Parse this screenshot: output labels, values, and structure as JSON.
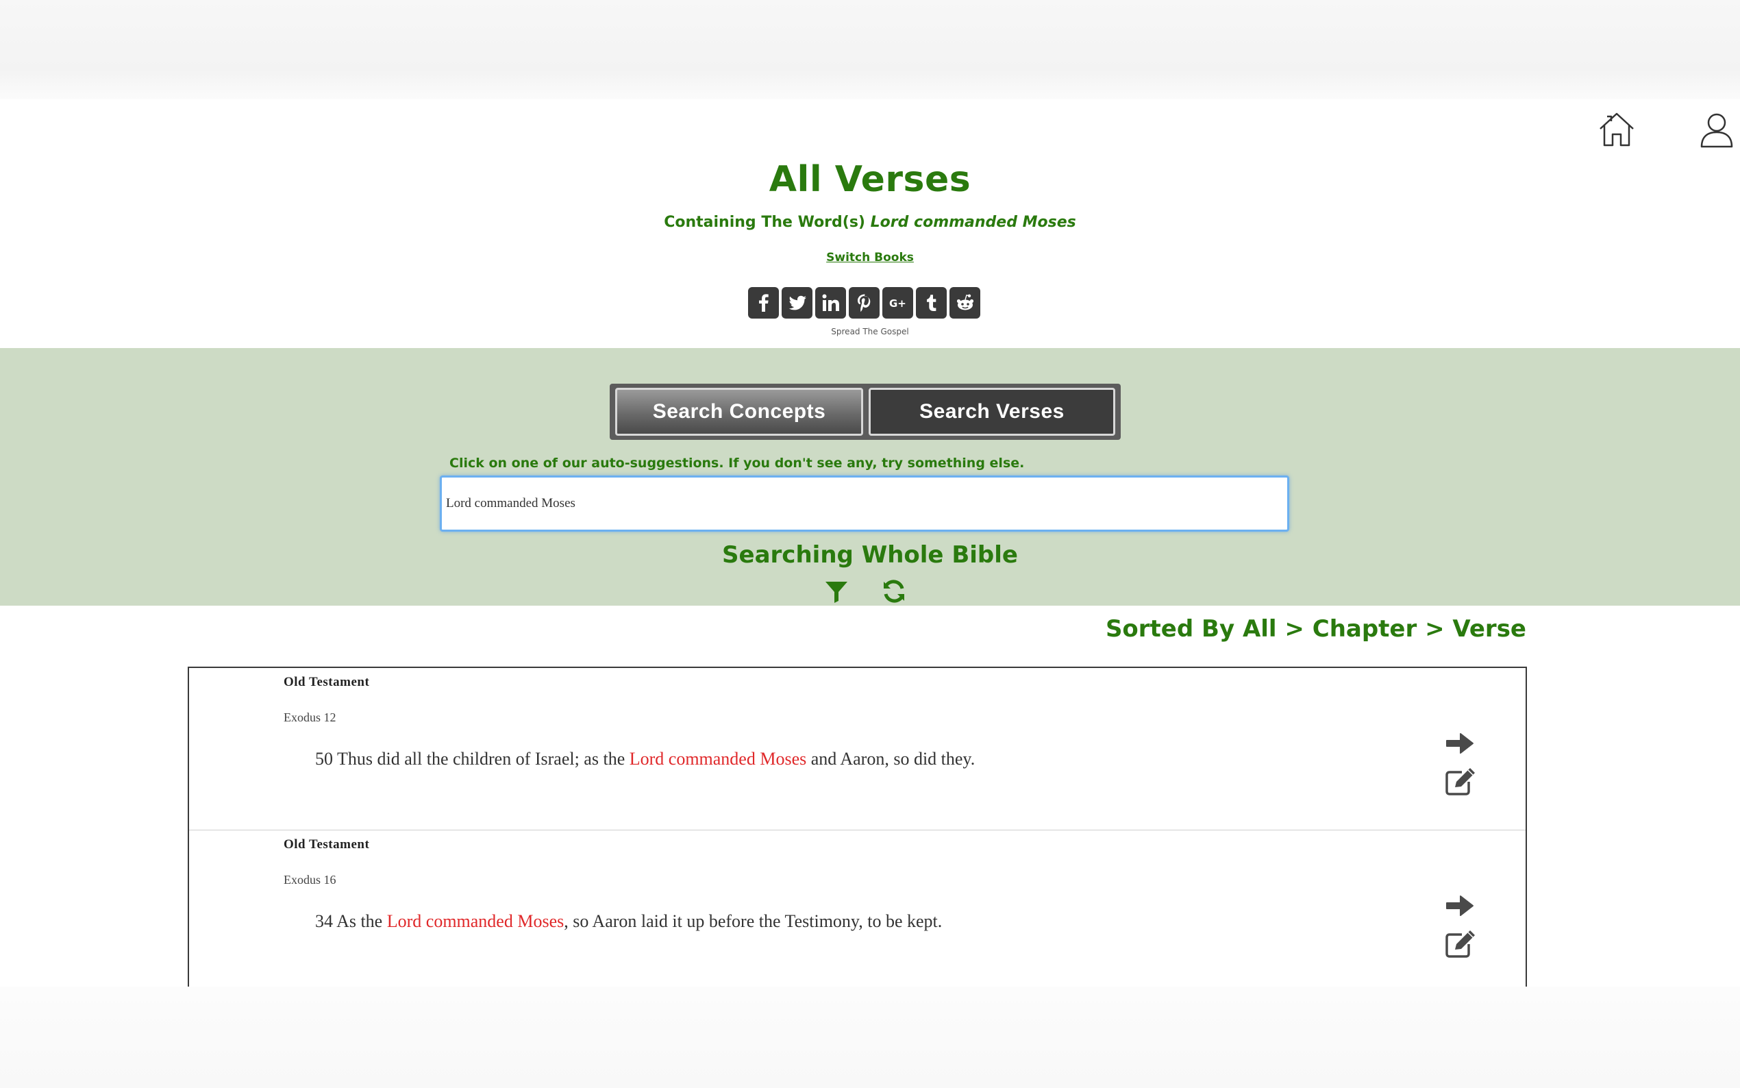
{
  "header": {
    "title": "All Verses",
    "subtitle_prefix": "Containing The Word(s)",
    "subtitle_query": "Lord commanded Moses",
    "switch_books_label": "Switch Books",
    "share_caption": "Spread The Gospel",
    "share_icons": [
      "facebook-icon",
      "twitter-icon",
      "linkedin-icon",
      "pinterest-icon",
      "google-plus-icon",
      "tumblr-icon",
      "reddit-icon"
    ]
  },
  "nav": {
    "icons": [
      "home-icon",
      "user-icon"
    ]
  },
  "search": {
    "tab_concepts": "Search Concepts",
    "tab_verses": "Search Verses",
    "hint": "Click on one of our auto-suggestions. If you don't see any, try something else.",
    "input_value": "Lord commanded Moses",
    "scope": "Searching Whole Bible",
    "icons": [
      "filter-icon",
      "refresh-icon"
    ]
  },
  "sort_label": "Sorted By All > Chapter > Verse",
  "results": [
    {
      "section": "Old Testament",
      "reference": "Exodus 12",
      "before": "50 Thus did all the children of Israel; as the ",
      "highlight": "Lord commanded Moses",
      "after": " and Aaron, so did they."
    },
    {
      "section": "Old Testament",
      "reference": "Exodus 16",
      "before": "34 As the ",
      "highlight": "Lord commanded Moses",
      "after": ", so Aaron laid it up before the Testimony, to be kept."
    }
  ],
  "colors": {
    "accent_green": "#2a7a0e",
    "band_green": "#cddbc5",
    "highlight_red": "#e0282a",
    "button_dark": "#3c3c3c"
  }
}
